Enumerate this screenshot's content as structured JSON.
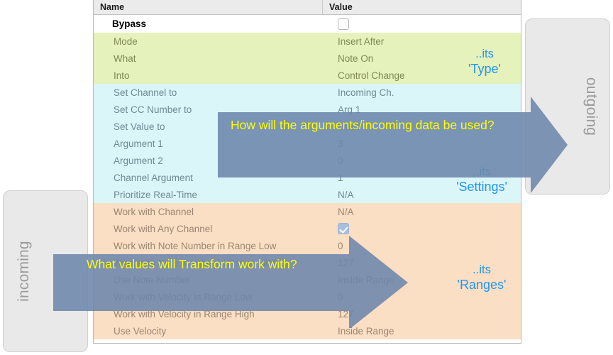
{
  "table": {
    "columns": {
      "name": "Name",
      "value": "Value"
    },
    "rows": [
      {
        "name": "Bypass",
        "value": "",
        "control": "checkbox-unchecked",
        "section": "bypass"
      },
      {
        "name": "Mode",
        "value": "Insert After",
        "section": "type"
      },
      {
        "name": "What",
        "value": "Note On",
        "section": "type"
      },
      {
        "name": "Into",
        "value": "Control Change",
        "section": "type"
      },
      {
        "name": "Set Channel to",
        "value": "Incoming Ch.",
        "section": "settings"
      },
      {
        "name": "Set CC Number to",
        "value": "Arg 1",
        "section": "settings"
      },
      {
        "name": "Set Value to",
        "value": "Value",
        "section": "settings"
      },
      {
        "name": "Argument 1",
        "value": "3",
        "section": "settings"
      },
      {
        "name": "Argument 2",
        "value": "0",
        "section": "settings"
      },
      {
        "name": "Channel Argument",
        "value": "1",
        "section": "settings"
      },
      {
        "name": "Prioritize Real-Time",
        "value": "N/A",
        "section": "settings"
      },
      {
        "name": "Work with Channel",
        "value": "N/A",
        "section": "ranges"
      },
      {
        "name": "Work with Any Channel",
        "value": "",
        "control": "checkbox-checked",
        "section": "ranges"
      },
      {
        "name": "Work with Note Number in Range Low",
        "value": "0",
        "section": "ranges"
      },
      {
        "name": "Work with Note Number in Range High",
        "value": "127",
        "section": "ranges"
      },
      {
        "name": "Use Note Number",
        "value": "Inside Range",
        "section": "ranges"
      },
      {
        "name": "Work with Velocity in Range Low",
        "value": "0",
        "section": "ranges"
      },
      {
        "name": "Work with Velocity in Range High",
        "value": "127",
        "section": "ranges"
      },
      {
        "name": "Use Velocity",
        "value": "Inside Range",
        "section": "ranges"
      }
    ]
  },
  "panels": {
    "incoming": "incoming",
    "outgoing": "outgoing"
  },
  "annotations": {
    "type": {
      "line1": "..its",
      "line2": "'Type'"
    },
    "settings": {
      "line1": "..its",
      "line2": "'Settings'"
    },
    "ranges": {
      "line1": "..its",
      "line2": "'Ranges'"
    }
  },
  "callouts": {
    "top": "How will the arguments/incoming data be used?",
    "bottom": "What values will Transform work with?"
  },
  "colors": {
    "section_type": "#e5f2bb",
    "section_settings": "#dbf6f8",
    "section_ranges": "#fbdfc4",
    "arrow": "#6c86ab",
    "callout_text": "#ffff00",
    "annotation_text": "#2196f3",
    "panel": "#e9e9e9"
  }
}
